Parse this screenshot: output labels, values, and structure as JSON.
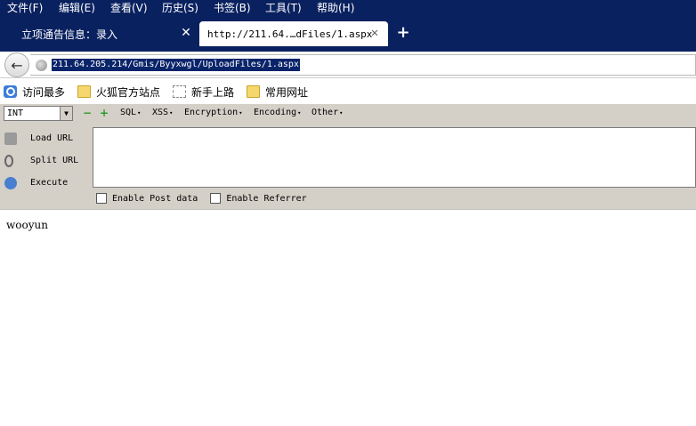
{
  "menubar": {
    "items": [
      "文件(F)",
      "编辑(E)",
      "查看(V)",
      "历史(S)",
      "书签(B)",
      "工具(T)",
      "帮助(H)"
    ]
  },
  "tabs": [
    {
      "label": "立项通告信息：录入",
      "close": "✕"
    },
    {
      "label": "http://211.64.…dFiles/1.aspx",
      "close": "✕"
    }
  ],
  "new_tab": "+",
  "address": {
    "url": "211.64.205.214/Gmis/Byyxwgl/UploadFiles/1.aspx"
  },
  "bookmarks": [
    {
      "label": "访问最多",
      "icon": "search-icon"
    },
    {
      "label": "火狐官方站点",
      "icon": "folder-icon"
    },
    {
      "label": "新手上路",
      "icon": "page-icon"
    },
    {
      "label": "常用网址",
      "icon": "folder-icon"
    }
  ],
  "hackbar": {
    "select_value": "INT",
    "menus": [
      "SQL",
      "XSS",
      "Encryption",
      "Encoding",
      "Other"
    ],
    "actions": [
      "Load URL",
      "Split URL",
      "Execute"
    ],
    "textarea_value": "",
    "checks": [
      "Enable Post data",
      "Enable Referrer"
    ]
  },
  "page": {
    "text": "wooyun"
  },
  "colors": {
    "titlebar": "#0a2160",
    "url_highlight": "#0a246a",
    "hackbar_bg": "#d4d0c8"
  }
}
